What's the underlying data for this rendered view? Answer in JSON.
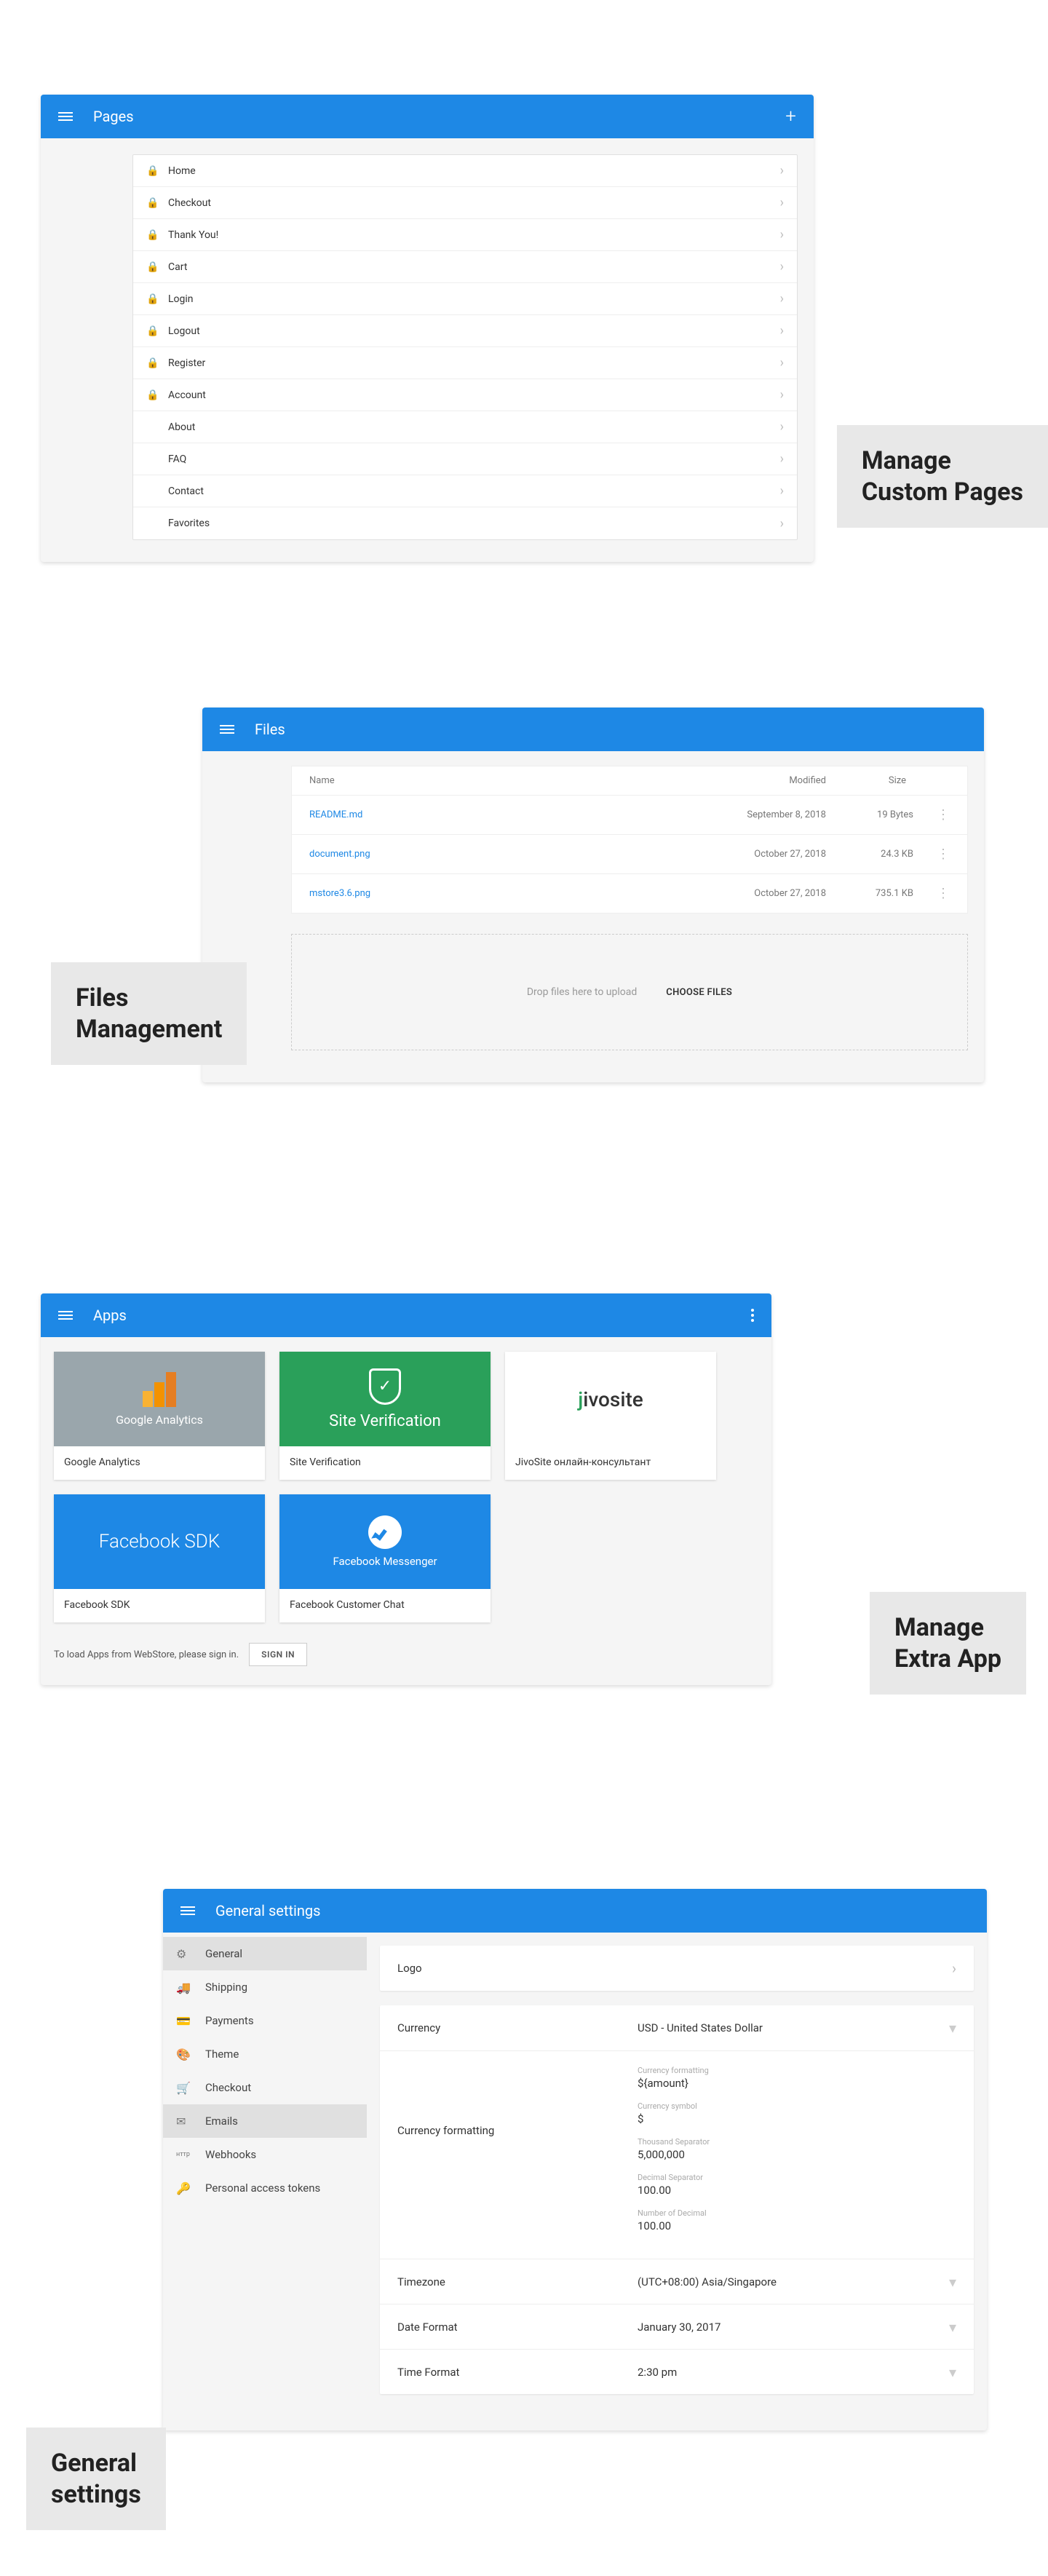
{
  "pages": {
    "title": "Pages",
    "side_label": "Manage\nCustom Pages",
    "items": [
      {
        "label": "Home",
        "locked": true
      },
      {
        "label": "Checkout",
        "locked": true
      },
      {
        "label": "Thank You!",
        "locked": true
      },
      {
        "label": "Cart",
        "locked": true
      },
      {
        "label": "Login",
        "locked": true
      },
      {
        "label": "Logout",
        "locked": true
      },
      {
        "label": "Register",
        "locked": true
      },
      {
        "label": "Account",
        "locked": true
      },
      {
        "label": "About",
        "locked": false
      },
      {
        "label": "FAQ",
        "locked": false
      },
      {
        "label": "Contact",
        "locked": false
      },
      {
        "label": "Favorites",
        "locked": false
      }
    ]
  },
  "files": {
    "title": "Files",
    "side_label": "Files\nManagement",
    "headers": {
      "name": "Name",
      "modified": "Modified",
      "size": "Size"
    },
    "rows": [
      {
        "name": "README.md",
        "modified": "September 8, 2018",
        "size": "19 Bytes"
      },
      {
        "name": "document.png",
        "modified": "October 27, 2018",
        "size": "24.3 KB"
      },
      {
        "name": "mstore3.6.png",
        "modified": "October 27, 2018",
        "size": "735.1 KB"
      }
    ],
    "drop_hint": "Drop files here to upload",
    "choose_label": "CHOOSE FILES"
  },
  "apps": {
    "title": "Apps",
    "side_label": "Manage\nExtra App",
    "cards": [
      {
        "thumb_label": "Google Analytics",
        "caption": "Google Analytics"
      },
      {
        "thumb_label": "Site Verification",
        "caption": "Site Verification"
      },
      {
        "thumb_label": "jivosite",
        "caption": "JivoSite онлайн-консультант"
      },
      {
        "thumb_label": "Facebook SDK",
        "caption": "Facebook SDK"
      },
      {
        "thumb_label": "Facebook Messenger",
        "caption": "Facebook Customer Chat"
      }
    ],
    "signin_text": "To load Apps from WebStore, please sign in.",
    "signin_button": "SIGN IN"
  },
  "settings": {
    "title": "General settings",
    "side_label": "General\nsettings",
    "sidebar": [
      {
        "icon": "⚙",
        "label": "General",
        "active": true
      },
      {
        "icon": "🚚",
        "label": "Shipping"
      },
      {
        "icon": "💳",
        "label": "Payments"
      },
      {
        "icon": "🎨",
        "label": "Theme"
      },
      {
        "icon": "🛒",
        "label": "Checkout"
      },
      {
        "icon": "✉",
        "label": "Emails",
        "active": true
      },
      {
        "icon": "нттр",
        "label": "Webhooks"
      },
      {
        "icon": "🔑",
        "label": "Personal access tokens"
      }
    ],
    "logo_label": "Logo",
    "currency_label": "Currency",
    "currency_value": "USD - United States Dollar",
    "formatting_label": "Currency formatting",
    "formatting": [
      {
        "hint": "Currency formatting",
        "val": "${amount}"
      },
      {
        "hint": "Currency symbol",
        "val": "$"
      },
      {
        "hint": "Thousand Separator",
        "val": "5,000,000"
      },
      {
        "hint": "Decimal Separator",
        "val": "100.00"
      },
      {
        "hint": "Number of Decimal",
        "val": "100.00"
      }
    ],
    "timezone_label": "Timezone",
    "timezone_value": "(UTC+08:00) Asia/Singapore",
    "date_label": "Date Format",
    "date_value": "January 30, 2017",
    "time_label": "Time Format",
    "time_value": "2:30 pm"
  }
}
